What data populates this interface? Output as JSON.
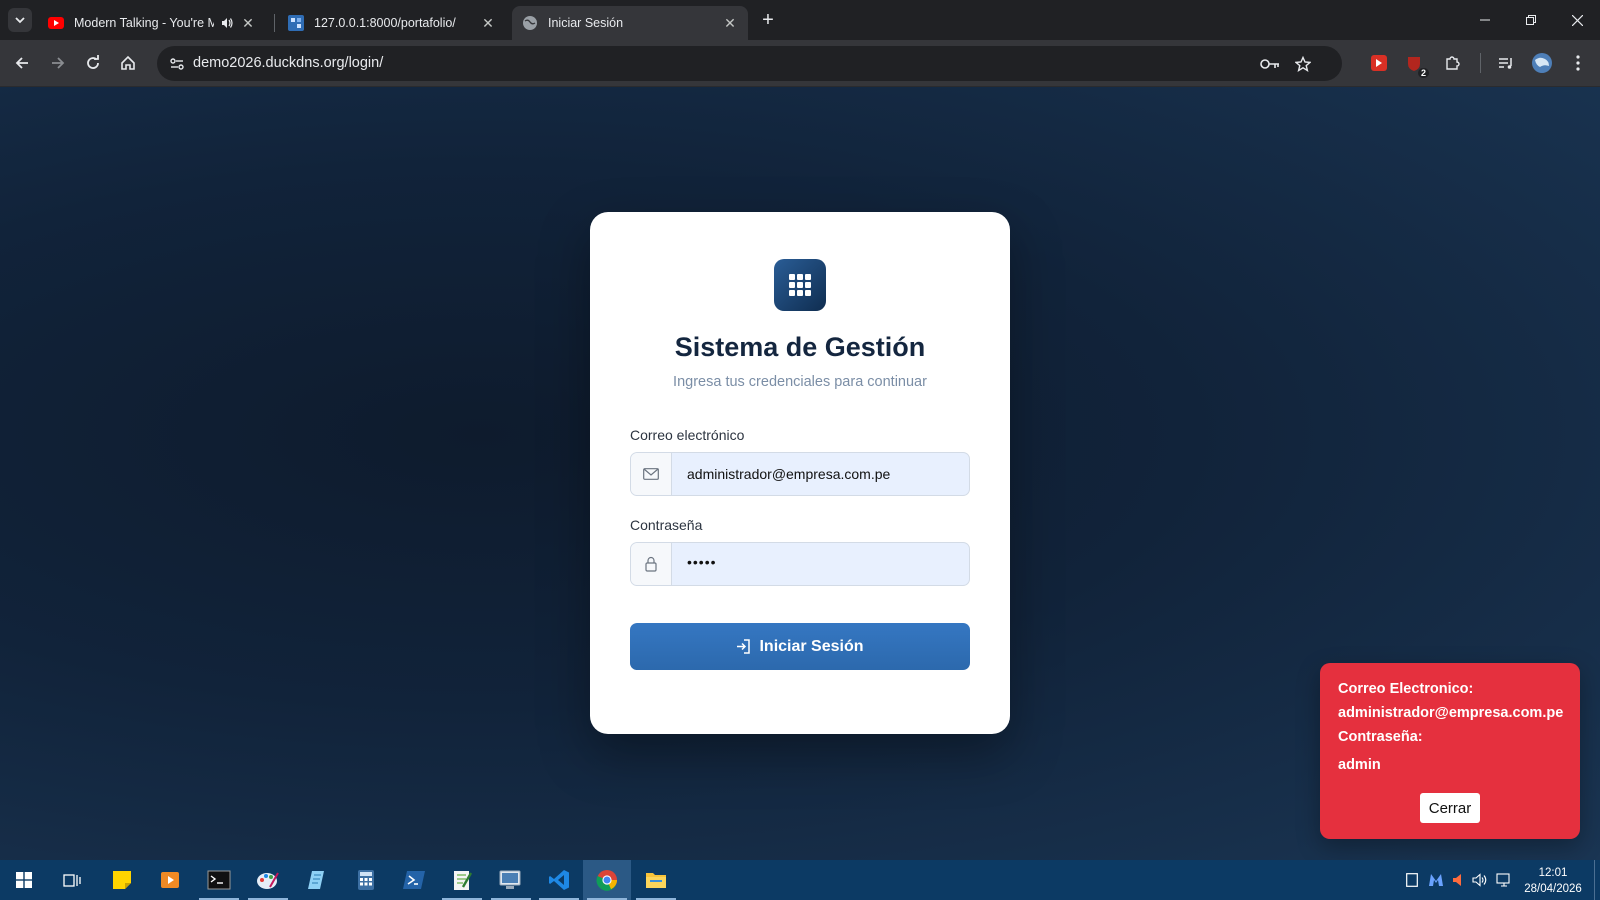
{
  "browser": {
    "tabs": [
      {
        "title": "Modern Talking - You're My Heart, You're My Soul",
        "favicon": "youtube-icon",
        "audio": true,
        "active": false
      },
      {
        "title": "127.0.0.1:8000/portafolio/",
        "favicon": "django-icon",
        "active": false
      },
      {
        "title": "Iniciar Sesión",
        "favicon": "globe-icon",
        "active": true
      }
    ],
    "url": "demo2026.duckdns.org/login/",
    "extension_badge": "2"
  },
  "login": {
    "title": "Sistema de Gestión",
    "subtitle": "Ingresa tus credenciales para continuar",
    "email_label": "Correo electrónico",
    "email_value": "administrador@empresa.com.pe",
    "password_label": "Contraseña",
    "password_value": "•••••",
    "submit_label": "Iniciar Sesión"
  },
  "toast": {
    "email_label": "Correo Electronico:",
    "email_value": "administrador@empresa.com.pe",
    "password_label": "Contraseña:",
    "password_value": "admin",
    "close_label": "Cerrar"
  },
  "taskbar": {
    "time": "12:01",
    "date": "28/04/2026",
    "apps": [
      "start-icon",
      "task-view-icon",
      "sticky-notes-icon",
      "media-player-icon",
      "terminal-icon",
      "paint-icon",
      "notepad-icon",
      "calculator-icon",
      "powershell-icon",
      "notepad-plus-icon",
      "remote-desktop-icon",
      "vscode-icon",
      "chrome-icon",
      "file-explorer-icon"
    ]
  },
  "colors": {
    "accent_button": "#3174bf",
    "toast_bg": "#e5303e",
    "card_bg": "#ffffff",
    "page_bg": "#11233a"
  }
}
